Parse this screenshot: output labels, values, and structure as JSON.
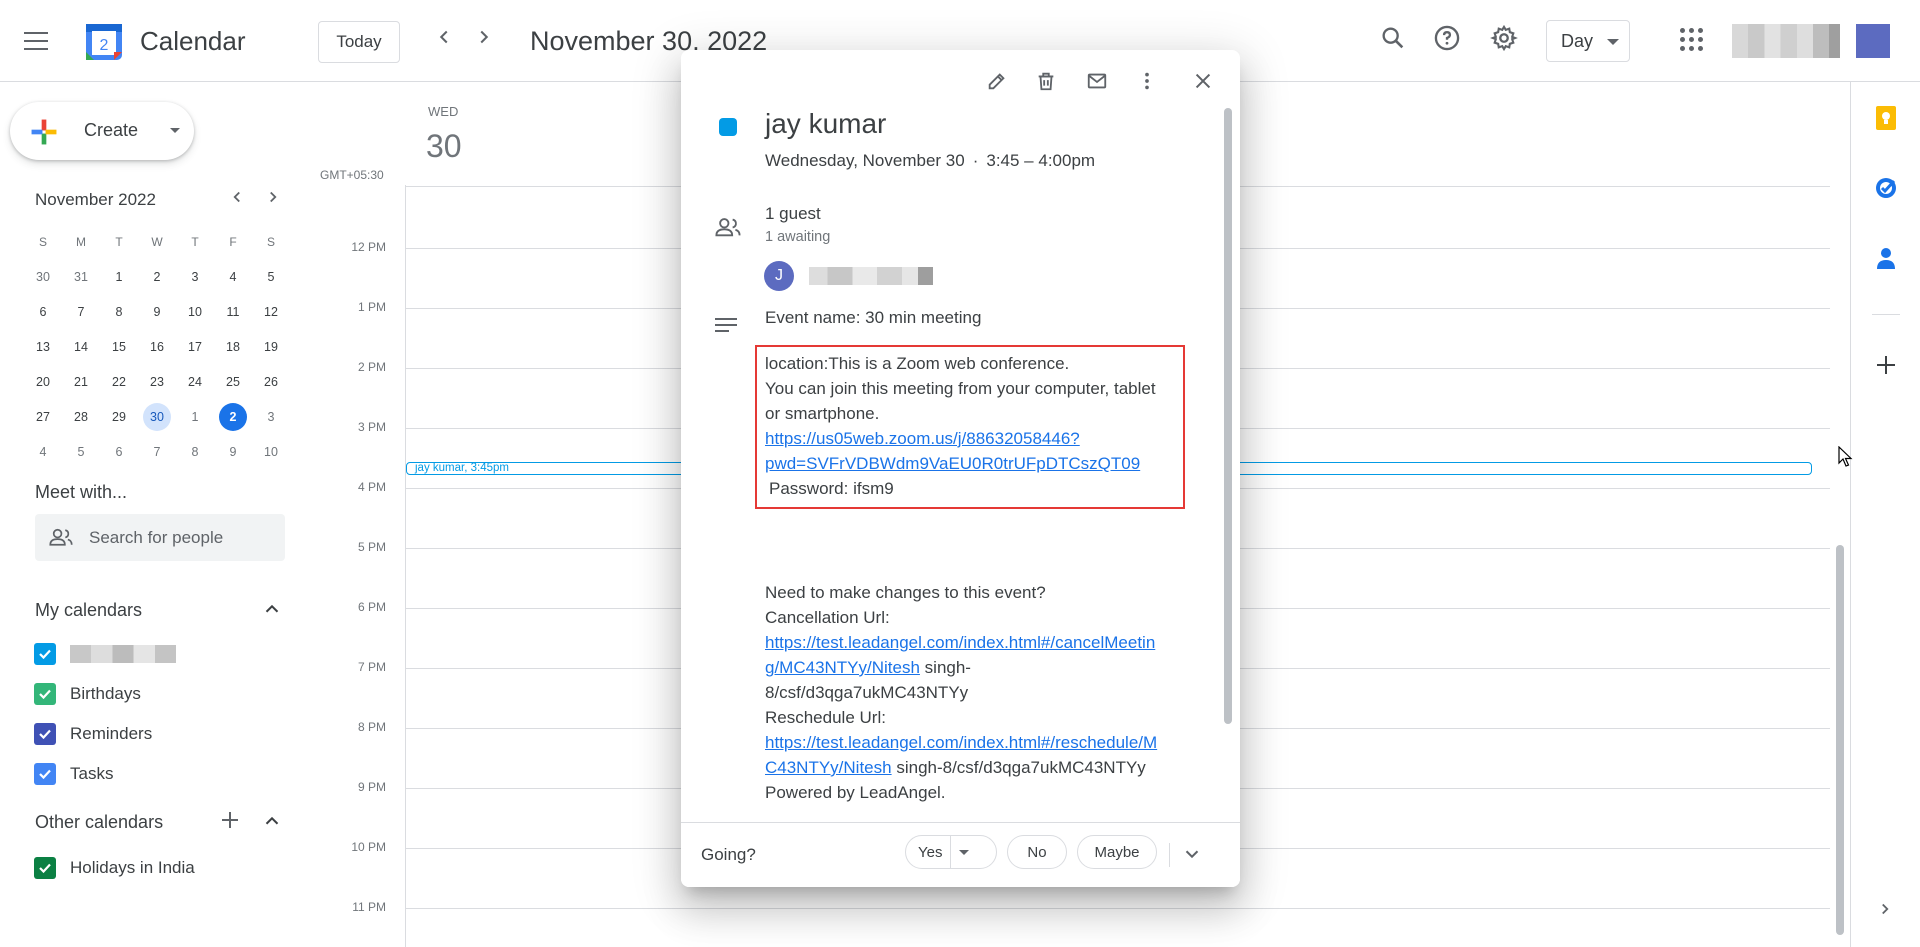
{
  "header": {
    "app_title": "Calendar",
    "logo_number": "2",
    "today_label": "Today",
    "date_title": "November 30, 2022",
    "view_select": "Day",
    "prev_icon": "chevron-left",
    "next_icon": "chevron-right"
  },
  "sidebar": {
    "create_label": "Create",
    "mini_cal": {
      "title": "November 2022",
      "weekdays": [
        "S",
        "M",
        "T",
        "W",
        "T",
        "F",
        "S"
      ],
      "weeks": [
        [
          "30",
          "31",
          "1",
          "2",
          "3",
          "4",
          "5"
        ],
        [
          "6",
          "7",
          "8",
          "9",
          "10",
          "11",
          "12"
        ],
        [
          "13",
          "14",
          "15",
          "16",
          "17",
          "18",
          "19"
        ],
        [
          "20",
          "21",
          "22",
          "23",
          "24",
          "25",
          "26"
        ],
        [
          "27",
          "28",
          "29",
          "30",
          "1",
          "2",
          "3"
        ],
        [
          "4",
          "5",
          "6",
          "7",
          "8",
          "9",
          "10"
        ]
      ]
    },
    "meet_title": "Meet with...",
    "search_placeholder": "Search for people",
    "my_calendars_title": "My calendars",
    "my_calendars": [
      {
        "label": "",
        "color": "#039be5",
        "blurred": true
      },
      {
        "label": "Birthdays",
        "color": "#33b679"
      },
      {
        "label": "Reminders",
        "color": "#3f51b5"
      },
      {
        "label": "Tasks",
        "color": "#4285f4"
      }
    ],
    "other_calendars_title": "Other calendars",
    "other_calendars": [
      {
        "label": "Holidays in India",
        "color": "#0b8043"
      }
    ]
  },
  "day_view": {
    "weekday": "WED",
    "day_number": "30",
    "timezone": "GMT+05:30",
    "hours": [
      "12 PM",
      "1 PM",
      "2 PM",
      "3 PM",
      "4 PM",
      "5 PM",
      "6 PM",
      "7 PM",
      "8 PM",
      "9 PM",
      "10 PM",
      "11 PM"
    ],
    "event_chip_title": "jay kumar",
    "event_chip_time": "3:45pm"
  },
  "popup": {
    "title": "jay kumar",
    "date": "Wednesday, November 30",
    "time": "3:45 – 4:00pm",
    "guests_count": "1 guest",
    "guests_awaiting": "1 awaiting",
    "guest_initial": "J",
    "event_name": "Event name: 30 min meeting",
    "location_line1": "location:This is a Zoom web conference.",
    "location_line2": "You can join this meeting from your computer, tablet",
    "location_line3": "or smartphone.",
    "zoom_link_line1": "https://us05web.zoom.us/j/88632058446?",
    "zoom_link_line2": "pwd=SVFrVDBWdm9VaEU0R0trUFpDTCszQT09",
    "password": "Password: ifsm9",
    "changes_title": "Need to make changes to this event?",
    "cancel_label": "Cancellation Url:",
    "cancel_link_line1": "https://test.leadangel.com/index.html#/cancelMeetin",
    "cancel_link_line2": "g/MC43NTYy/Nitesh",
    "cancel_suffix_line2": " singh-",
    "cancel_line3": "8/csf/d3qga7ukMC43NTYy",
    "reschedule_label": "Reschedule Url:",
    "reschedule_link_line1": "https://test.leadangel.com/index.html#/reschedule/M",
    "reschedule_link_line2": "C43NTYy/Nitesh",
    "reschedule_suffix": " singh-8/csf/d3qga7ukMC43NTYy",
    "powered_by": "Powered by LeadAngel.",
    "going_label": "Going?",
    "yes_label": "Yes",
    "no_label": "No",
    "maybe_label": "Maybe"
  },
  "colors": {
    "event": "#039be5",
    "accent": "#1a73e8",
    "highlight_box": "#e53935"
  }
}
